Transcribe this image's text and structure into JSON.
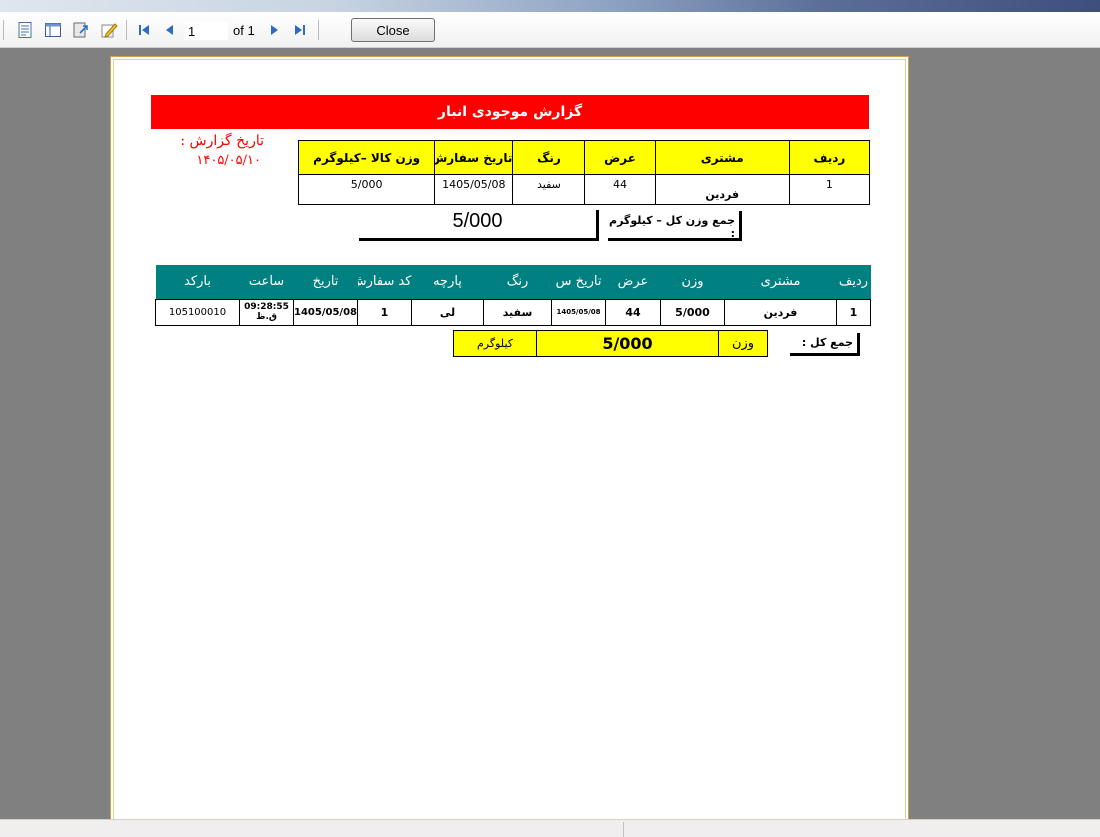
{
  "toolbar": {
    "current_page": "1",
    "of_label": "of 1",
    "close_label": "Close"
  },
  "report": {
    "title": "گزارش موجودی انبار",
    "date_label": "تاریخ گزارش :",
    "date_value": "۱۴۰۵/۰۵/۱۰",
    "accent_color": "#ff0000",
    "header_fill": "#ffff00",
    "teal_fill": "#008080"
  },
  "summary_table": {
    "headers": [
      "ردیف",
      "مشتری",
      "عرض",
      "رنگ",
      "تاریخ سفارش",
      "وزن کالا –کیلوگرم"
    ],
    "rows": [
      [
        "1",
        "فردین",
        "44",
        "سفید",
        "1405/05/08",
        "5/000"
      ]
    ]
  },
  "summary_total": {
    "label": "جمع وزن کل – کیلوگرم :",
    "value": "5/000"
  },
  "detail_table": {
    "headers": [
      "ردیف",
      "مشتری",
      "وزن",
      "عرض",
      "تاریخ س",
      "رنگ",
      "پارچه",
      "کد سفارش",
      "تاریخ",
      "ساعت",
      "بارکد"
    ],
    "rows": [
      [
        "1",
        "فردین",
        "5/000",
        "44",
        "1405/05/08",
        "سفید",
        "لی",
        "1",
        "1405/05/08",
        "09:28:55",
        "ق.ظ",
        "105100010"
      ]
    ]
  },
  "grand_total": {
    "label": "جمع کل :",
    "weight_label": "وزن",
    "value": "5/000",
    "unit": "کیلوگرم"
  }
}
